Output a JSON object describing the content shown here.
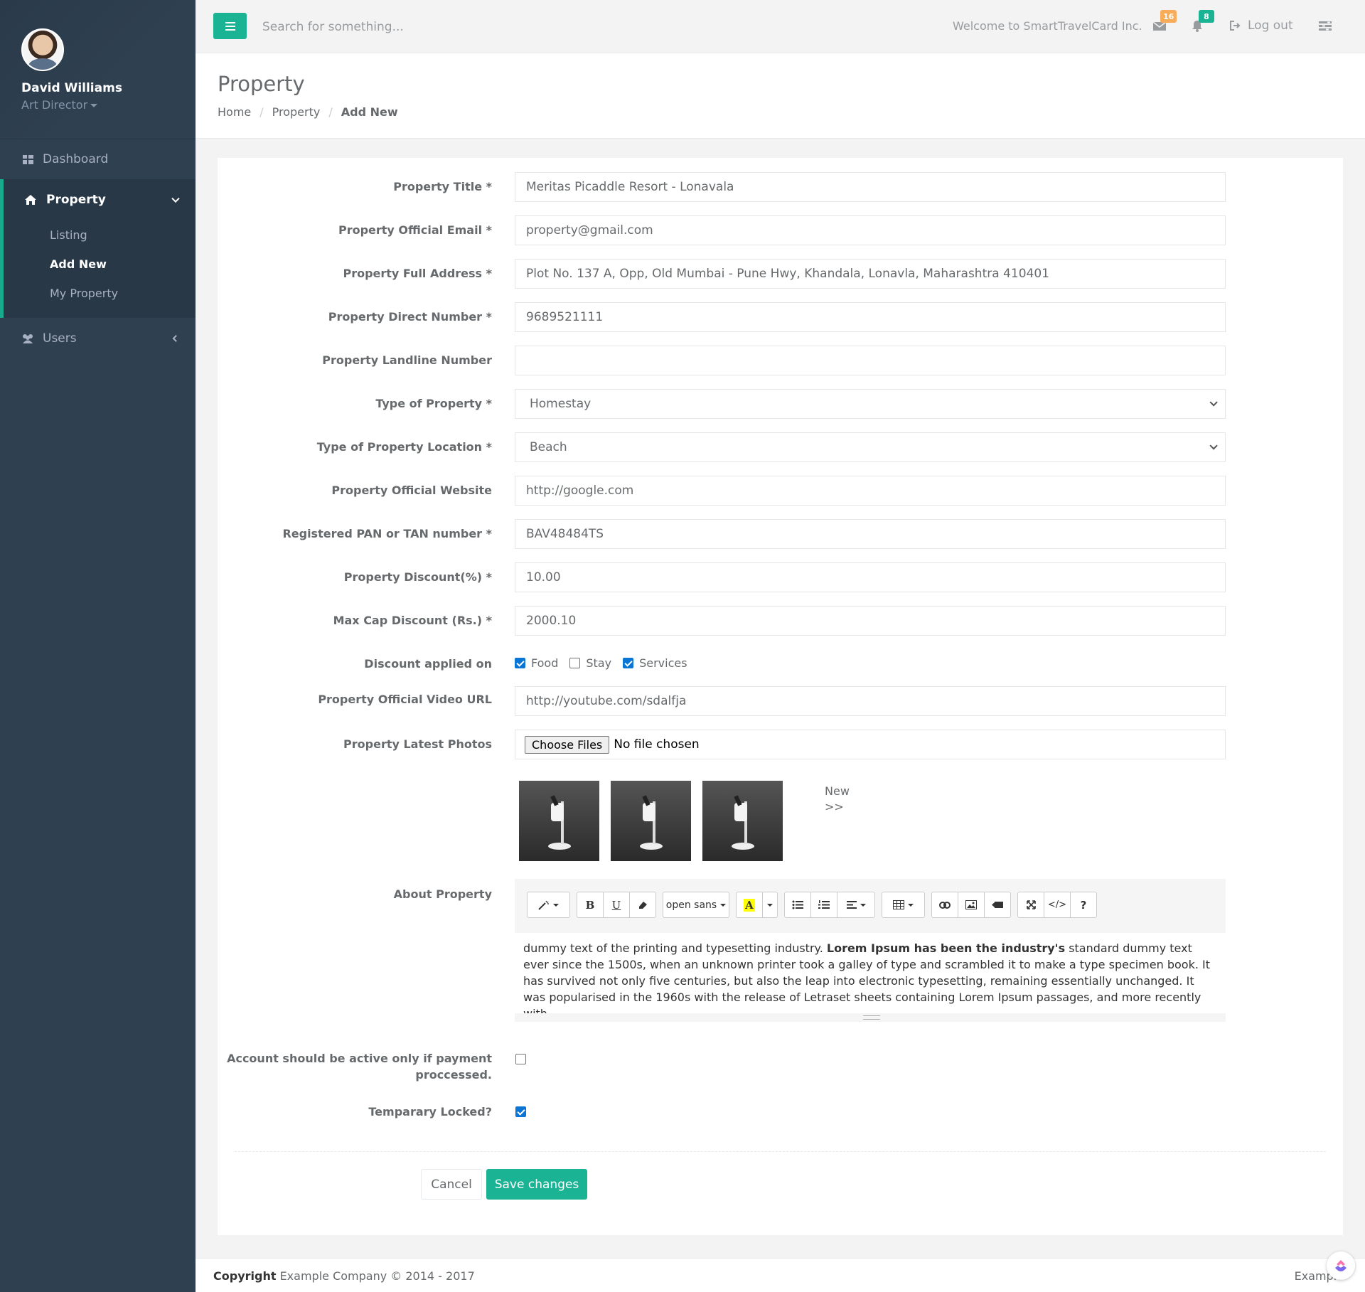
{
  "colors": {
    "sidebar_bg": "#2f4050",
    "accent": "#1ab394",
    "badge_warning": "#f8ac59",
    "checkbox_checked": "#0b75d6"
  },
  "user": {
    "name": "David Williams",
    "role": "Art Director"
  },
  "sidebar": {
    "dashboard": "Dashboard",
    "property": "Property",
    "property_sub": [
      "Listing",
      "Add New",
      "My Property"
    ],
    "users": "Users"
  },
  "topbar": {
    "search_placeholder": "Search for something...",
    "welcome": "Welcome to SmartTravelCard Inc.",
    "messages_count": "16",
    "alerts_count": "8",
    "logout": "Log out"
  },
  "heading": {
    "title": "Property",
    "breadcrumb": [
      "Home",
      "Property",
      "Add New"
    ]
  },
  "form": {
    "title_label": "Property Title *",
    "title_value": "Meritas Picaddle Resort - Lonavala",
    "email_label": "Property Official Email *",
    "email_value": "property@gmail.com",
    "address_label": "Property Full Address *",
    "address_value": "Plot No. 137 A, Opp, Old Mumbai - Pune Hwy, Khandala, Lonavla, Maharashtra 410401",
    "direct_label": "Property Direct Number *",
    "direct_value": "9689521111",
    "landline_label": "Property Landline Number",
    "landline_value": "",
    "type_label": "Type of Property *",
    "type_value": "Homestay",
    "location_label": "Type of Property Location *",
    "location_value": "Beach",
    "website_label": "Property Official Website",
    "website_value": "http://google.com",
    "pan_label": "Registered PAN or TAN number *",
    "pan_value": "BAV48484TS",
    "discount_label": "Property Discount(%) *",
    "discount_value": "10.00",
    "maxcap_label": "Max Cap Discount (Rs.) *",
    "maxcap_value": "2000.10",
    "applied_label": "Discount applied on",
    "applied_food": "Food",
    "applied_stay": "Stay",
    "applied_services": "Services",
    "video_label": "Property Official Video URL",
    "video_value": "http://youtube.com/sdalfja",
    "photos_label": "Property Latest Photos",
    "choose_files": "Choose Files",
    "no_file": "No file chosen",
    "new_link_1": "New",
    "new_link_2": ">>",
    "about_label": "About Property",
    "font_name": "open sans",
    "about_text_1": "dummy text of the printing and typesetting industry. ",
    "about_text_bold": "Lorem Ipsum has been the industry's",
    "about_text_2": " standard dummy text ever since the 1500s, when an unknown printer took a galley of type and scrambled it to make a type specimen book. It has survived not only five centuries, but also the leap into electronic typesetting, remaining essentially unchanged. It was popularised in the 1960s with the release of Letraset sheets containing Lorem Ipsum passages, and more recently with",
    "active_label_1": "Account should be active only if payment",
    "active_label_2": "proccessed.",
    "locked_label": "Temparary Locked?",
    "cancel": "Cancel",
    "save": "Save changes"
  },
  "footer": {
    "copyright_bold": "Copyright",
    "copyright_text": " Example Company © 2014 - 2017",
    "right": "Example"
  }
}
